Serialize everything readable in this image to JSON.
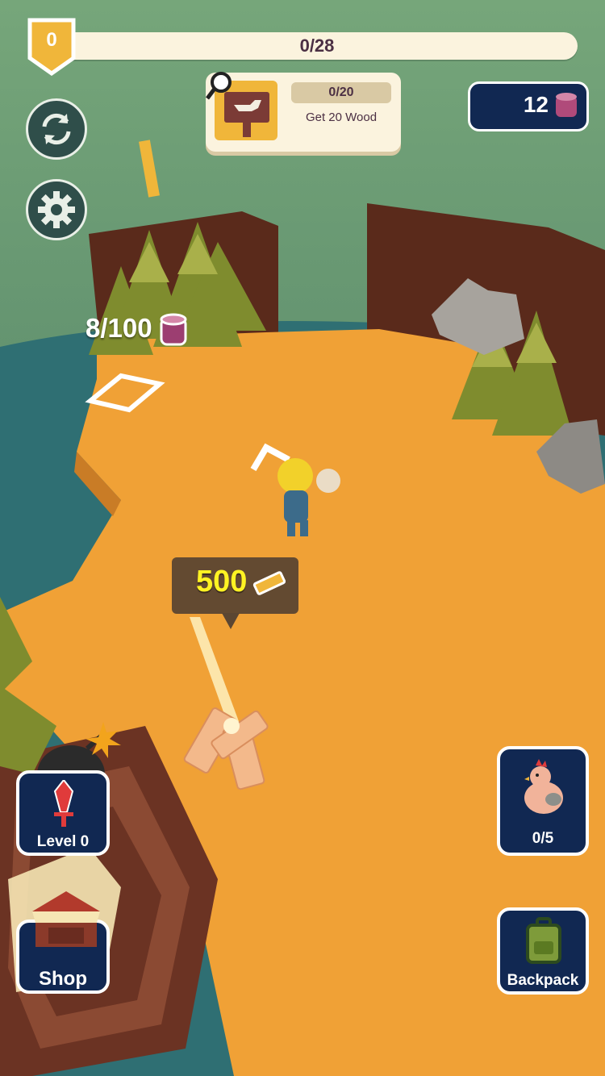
{
  "hud": {
    "level_badge": "0",
    "progress_text": "0/28"
  },
  "quest": {
    "progress": "0/20",
    "description": "Get 20 Wood"
  },
  "wood": {
    "count": "12"
  },
  "tree_goal": {
    "text": "8/100"
  },
  "unlock_price": {
    "amount": "500"
  },
  "buttons": {
    "level_label": "Level 0",
    "shop_label": "Shop",
    "animals_label": "0/5",
    "backpack_label": "Backpack"
  },
  "colors": {
    "ground": "#f0a136",
    "water": "#2f6f73",
    "panel_dark": "#112852",
    "hud_cream": "#fbf3de",
    "accent_gold": "#f0b63a"
  }
}
